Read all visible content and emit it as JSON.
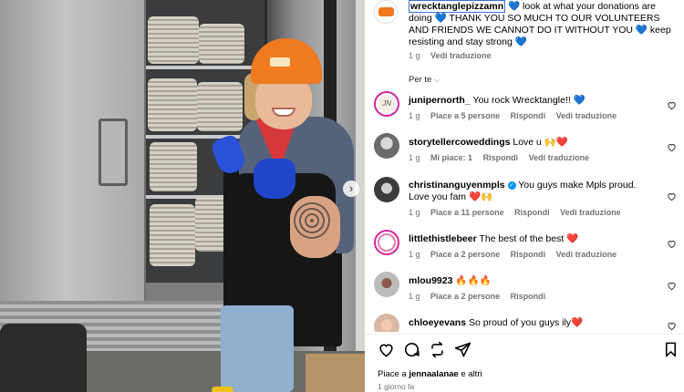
{
  "post": {
    "author": "wrecktanglepizzamn",
    "caption_rest": "💙 look at what your donations are doing 💙 THANK YOU SO MUCH TO OUR VOLUNTEERS AND FRIENDS WE CANNOT DO IT WITHOUT YOU 💙 keep resisting and stay strong 💙",
    "time": "1 g",
    "translate": "Vedi traduzione"
  },
  "sort_label": "Per te",
  "comments": [
    {
      "user": "junipernorth_",
      "text": "You rock Wrecktangle!! 💙",
      "time": "1 g",
      "likes": "Piace a 5 persone",
      "reply": "Rispondi",
      "translate": "Vedi traduzione"
    },
    {
      "user": "storytellercoweddings",
      "text": "Love u 🙌❤️",
      "time": "1 g",
      "likes": "Mi piace: 1",
      "reply": "Rispondi",
      "translate": "Vedi traduzione"
    },
    {
      "user": "christinanguyenmpls",
      "text": "You guys make Mpls proud. Love you fam ❤️🙌",
      "time": "1 g",
      "likes": "Piace a 11 persone",
      "reply": "Rispondi",
      "translate": "Vedi traduzione"
    },
    {
      "user": "littlethistlebeer",
      "text": "The best of the best ❤️",
      "time": "1 g",
      "likes": "Piace a 2 persone",
      "reply": "Rispondi",
      "translate": "Vedi traduzione"
    },
    {
      "user": "mlou9923",
      "text": "🔥🔥🔥",
      "time": "1 g",
      "likes": "Piace a 2 persone",
      "reply": "Rispondi"
    },
    {
      "user": "chloeyevans",
      "text": "So proud of you guys ily❤️",
      "time": "",
      "likes": "",
      "reply": ""
    }
  ],
  "footer": {
    "liked_by_prefix": "Piace a",
    "liked_by_user": "jennaalanae",
    "liked_by_suffix": "e altri",
    "posted": "1 giorno fa"
  },
  "icons": [
    "heart-icon",
    "comment-icon",
    "repost-icon",
    "share-icon",
    "bookmark-icon",
    "chevron-down-icon",
    "verified-icon",
    "chevron-right-icon"
  ],
  "colors": {
    "accent_blue": "#0095f6",
    "meta_gray": "#737373",
    "verified": "#0095f6"
  }
}
